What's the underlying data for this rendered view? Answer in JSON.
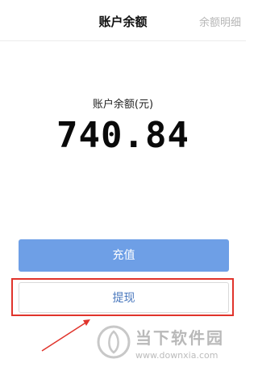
{
  "header": {
    "title": "账户余额",
    "link": "余额明细"
  },
  "balance": {
    "label": "账户余额(元)",
    "amount": "740.84"
  },
  "actions": {
    "recharge": "充值",
    "withdraw": "提现"
  },
  "watermark": {
    "title": "当下软件园",
    "url": "www.downxia.com"
  },
  "colors": {
    "primary_button": "#6e9fe6",
    "withdraw_text": "#4a78bd",
    "annotation_red": "#e0342c"
  }
}
